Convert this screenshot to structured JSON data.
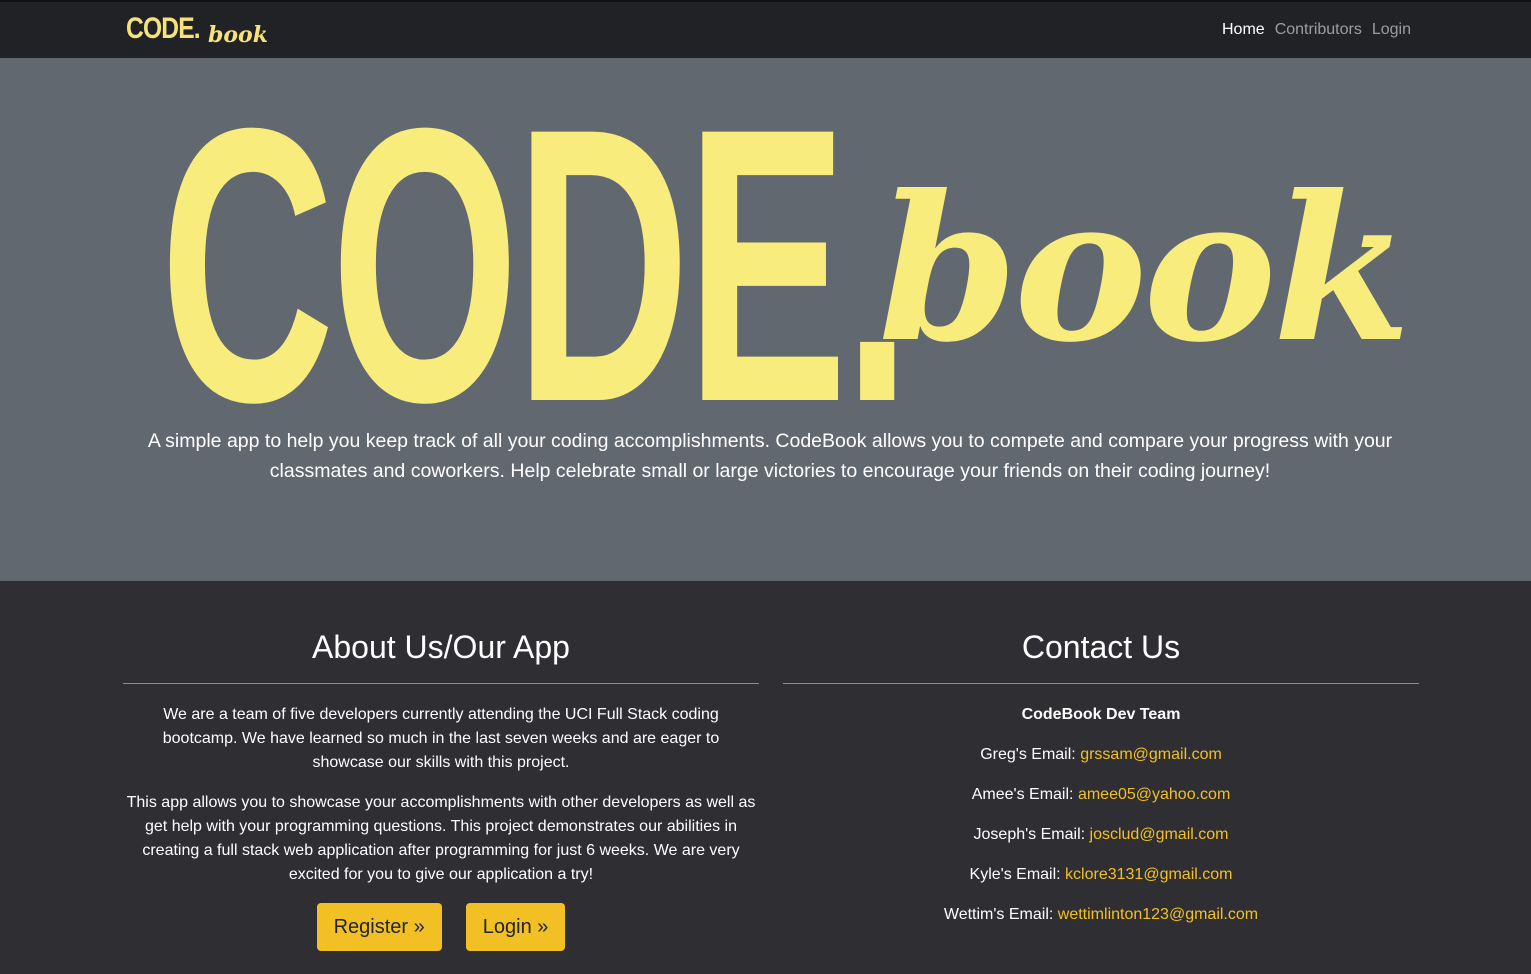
{
  "navbar": {
    "brand_code": "CODE.",
    "brand_book": "book",
    "links": [
      {
        "label": "Home",
        "active": true
      },
      {
        "label": "Contributors",
        "active": false
      },
      {
        "label": "Login",
        "active": false
      }
    ]
  },
  "hero": {
    "logo_code": "CODE.",
    "logo_book": "book",
    "description": "A simple app to help you keep track of all your coding accomplishments. CodeBook allows you to compete and compare your progress with your classmates and coworkers. Help celebrate small or large victories to encourage your friends on their coding journey!"
  },
  "about": {
    "heading": "About Us/Our App",
    "p1": "We are a team of five developers currently attending the UCI Full Stack coding bootcamp. We have learned so much in the last seven weeks and are eager to showcase our skills with this project.",
    "p2": "This app allows you to showcase your accomplishments with other developers as well as get help with your programming questions. This project demonstrates our abilities in creating a full stack web application after programming for just 6 weeks. We are very excited for you to give our application a try!",
    "register_label": "Register »",
    "login_label": "Login »"
  },
  "contact": {
    "heading": "Contact Us",
    "team": "CodeBook Dev Team",
    "emails": [
      {
        "label": "Greg's Email:",
        "email": "grssam@gmail.com"
      },
      {
        "label": "Amee's Email:",
        "email": "amee05@yahoo.com"
      },
      {
        "label": "Joseph's Email:",
        "email": "josclud@gmail.com"
      },
      {
        "label": "Kyle's Email:",
        "email": "kclore3131@gmail.com"
      },
      {
        "label": "Wettim's Email:",
        "email": "wettimlinton123@gmail.com"
      }
    ]
  },
  "colors": {
    "accent": "#f2c024",
    "logo_yellow": "#f8ec7c",
    "hero_bg": "#626870",
    "nav_bg": "#212225",
    "body_bg": "#2e2e33"
  }
}
